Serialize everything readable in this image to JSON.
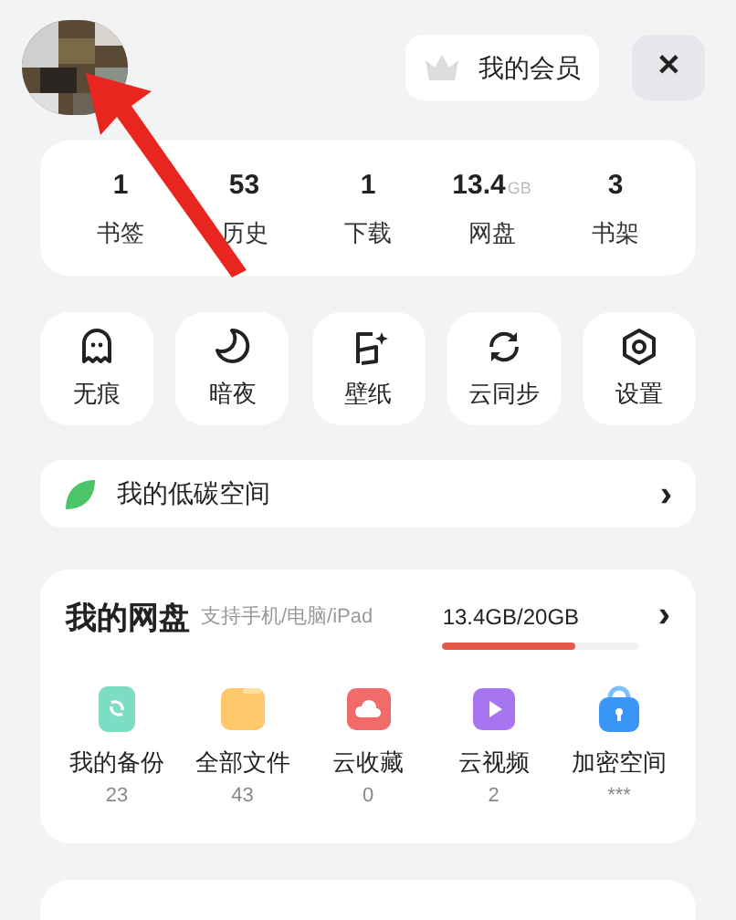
{
  "header": {
    "member_button": "我的会员",
    "close_button": "✕"
  },
  "stats": [
    {
      "value": "1",
      "label": "书签"
    },
    {
      "value": "53",
      "label": "历史"
    },
    {
      "value": "1",
      "label": "下载"
    },
    {
      "value": "13.4",
      "unit": "GB",
      "label": "网盘"
    },
    {
      "value": "3",
      "label": "书架"
    }
  ],
  "shortcuts": [
    {
      "kind": "ghost",
      "label": "无痕"
    },
    {
      "kind": "moon",
      "label": "暗夜"
    },
    {
      "kind": "wallpaper",
      "label": "壁纸"
    },
    {
      "kind": "sync",
      "label": "云同步"
    },
    {
      "kind": "settings",
      "label": "设置"
    }
  ],
  "low_carbon": {
    "label": "我的低碳空间",
    "chevron": "›"
  },
  "netdisk": {
    "title": "我的网盘",
    "subtitle": "支持手机/电脑/iPad",
    "usage": "13.4GB/20GB",
    "chevron": "›",
    "level": 0.67,
    "items": [
      {
        "kind": "backup",
        "label": "我的备份",
        "count": "23"
      },
      {
        "kind": "folder",
        "label": "全部文件",
        "count": "43"
      },
      {
        "kind": "cloud",
        "label": "云收藏",
        "count": "0"
      },
      {
        "kind": "video",
        "label": "云视频",
        "count": "2"
      },
      {
        "kind": "lock",
        "label": "加密空间",
        "count": "***"
      }
    ]
  }
}
